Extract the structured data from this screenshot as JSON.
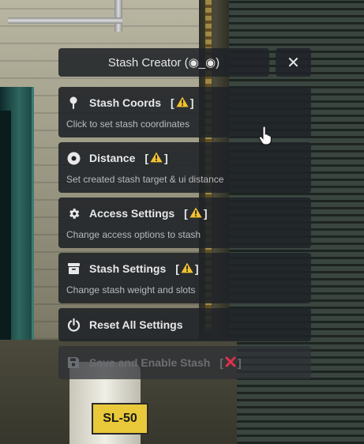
{
  "header": {
    "title": "Stash Creator (◉_◉)",
    "close_label": "✕"
  },
  "menu": {
    "items": [
      {
        "label": "Stash Coords",
        "status": "warning",
        "description": "Click to set stash coordinates",
        "icon": "map-pin-icon"
      },
      {
        "label": "Distance",
        "status": "warning",
        "description": "Set created stash target & ui distance",
        "icon": "circle-dot-icon"
      },
      {
        "label": "Access Settings",
        "status": "warning",
        "description": "Change access options to stash",
        "icon": "gear-icon"
      },
      {
        "label": "Stash Settings",
        "status": "warning",
        "description": "Change stash weight and slots",
        "icon": "box-icon"
      },
      {
        "label": "Reset All Settings",
        "icon": "power-icon"
      },
      {
        "label": "Save and Enable Stash",
        "status": "error",
        "icon": "floppy-disk-icon",
        "disabled": true
      }
    ]
  },
  "background": {
    "container_label": "SL-50"
  },
  "colors": {
    "panel": "#202328",
    "text": "#e8e8e8",
    "subtext": "#b8babc",
    "warning": "#f2c12e",
    "error": "#e0304e",
    "disabled_text": "#6b6e72"
  }
}
